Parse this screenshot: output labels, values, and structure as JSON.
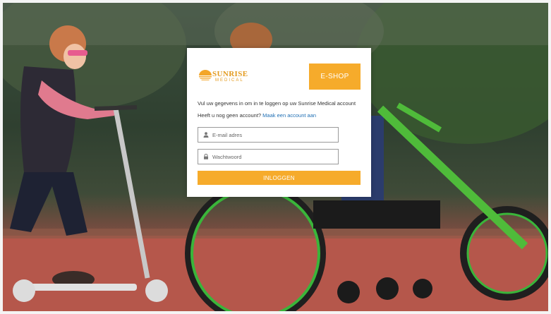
{
  "brand": {
    "name": "SUNRISE",
    "sub": "MEDICAL",
    "color": "#e39a1d"
  },
  "header": {
    "eshop_label": "E-SHOP"
  },
  "login": {
    "intro": "Vul uw gegevens in om in te loggen op uw Sunrise Medical account",
    "no_account_text": "Heeft u nog geen account?",
    "create_account_link": "Maak een account aan",
    "email_placeholder": "E-mail adres",
    "email_value": "",
    "password_placeholder": "Wachtwoord",
    "password_value": "",
    "submit_label": "INLOGGEN"
  },
  "colors": {
    "accent": "#f6ab2b",
    "link": "#1f6fb4"
  },
  "icons": {
    "email": "user-icon",
    "password": "lock-icon",
    "logo": "sun-icon"
  }
}
